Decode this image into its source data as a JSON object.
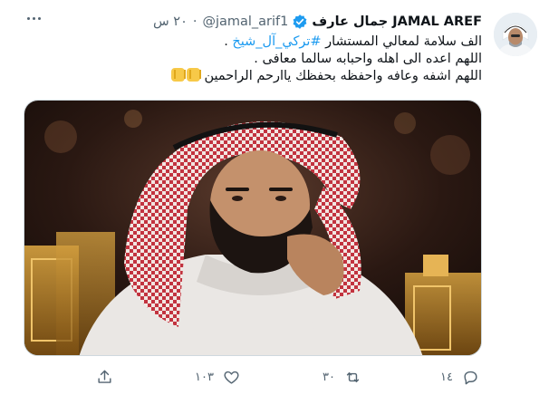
{
  "tweet": {
    "author_name": "جمال عارف JAMAL AREF",
    "handle": "@jamal_arif1",
    "separator": "·",
    "time": "٢٠ س",
    "lines": {
      "l1_prefix": "الف سلامة لمعالي المستشار ",
      "l1_hashtag": "#تركي_آل_شيخ",
      "l1_suffix": " .",
      "l2": "اللهم اعده الى اهله واحبابه سالما معافى .",
      "l3": "اللهم اشفه وعافه واحفظه بحفظك ياارحم الراحمين"
    },
    "emoji_names": [
      "praying-hands-icon",
      "praying-hands-icon"
    ],
    "icons": {
      "verified": "verified-badge-icon",
      "more": "more-icon",
      "reply": "reply-icon",
      "retweet": "retweet-icon",
      "like": "heart-icon",
      "share": "share-icon"
    },
    "stats": {
      "replies": "١٤",
      "retweets": "٣٠",
      "likes": "١٠٣"
    },
    "colors": {
      "accent": "#1d9bf0",
      "muted": "#536471",
      "text": "#0f1419"
    }
  }
}
